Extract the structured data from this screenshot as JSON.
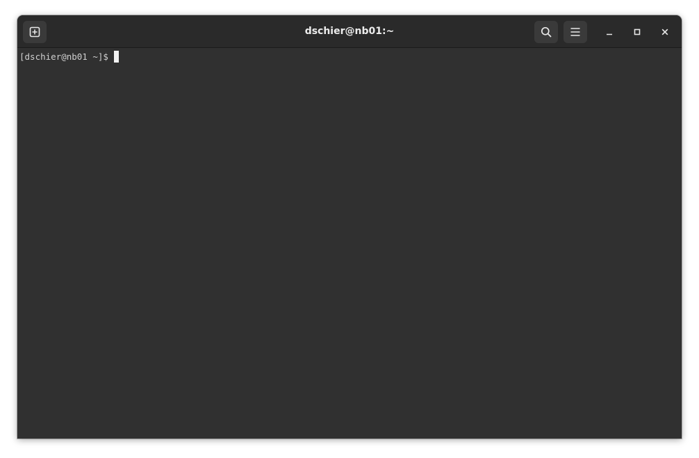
{
  "window": {
    "title": "dschier@nb01:~"
  },
  "headerbar": {
    "new_tab_icon": "tab-new-icon",
    "search_icon": "search-icon",
    "menu_icon": "hamburger-menu-icon",
    "minimize_icon": "minimize-icon",
    "maximize_icon": "maximize-icon",
    "close_icon": "close-icon"
  },
  "terminal": {
    "prompt": "[dschier@nb01 ~]$"
  },
  "colors": {
    "background": "#303030",
    "headerbar": "#2a2a2a",
    "text": "#d0d0d0",
    "cursor": "#f2f2f2"
  }
}
